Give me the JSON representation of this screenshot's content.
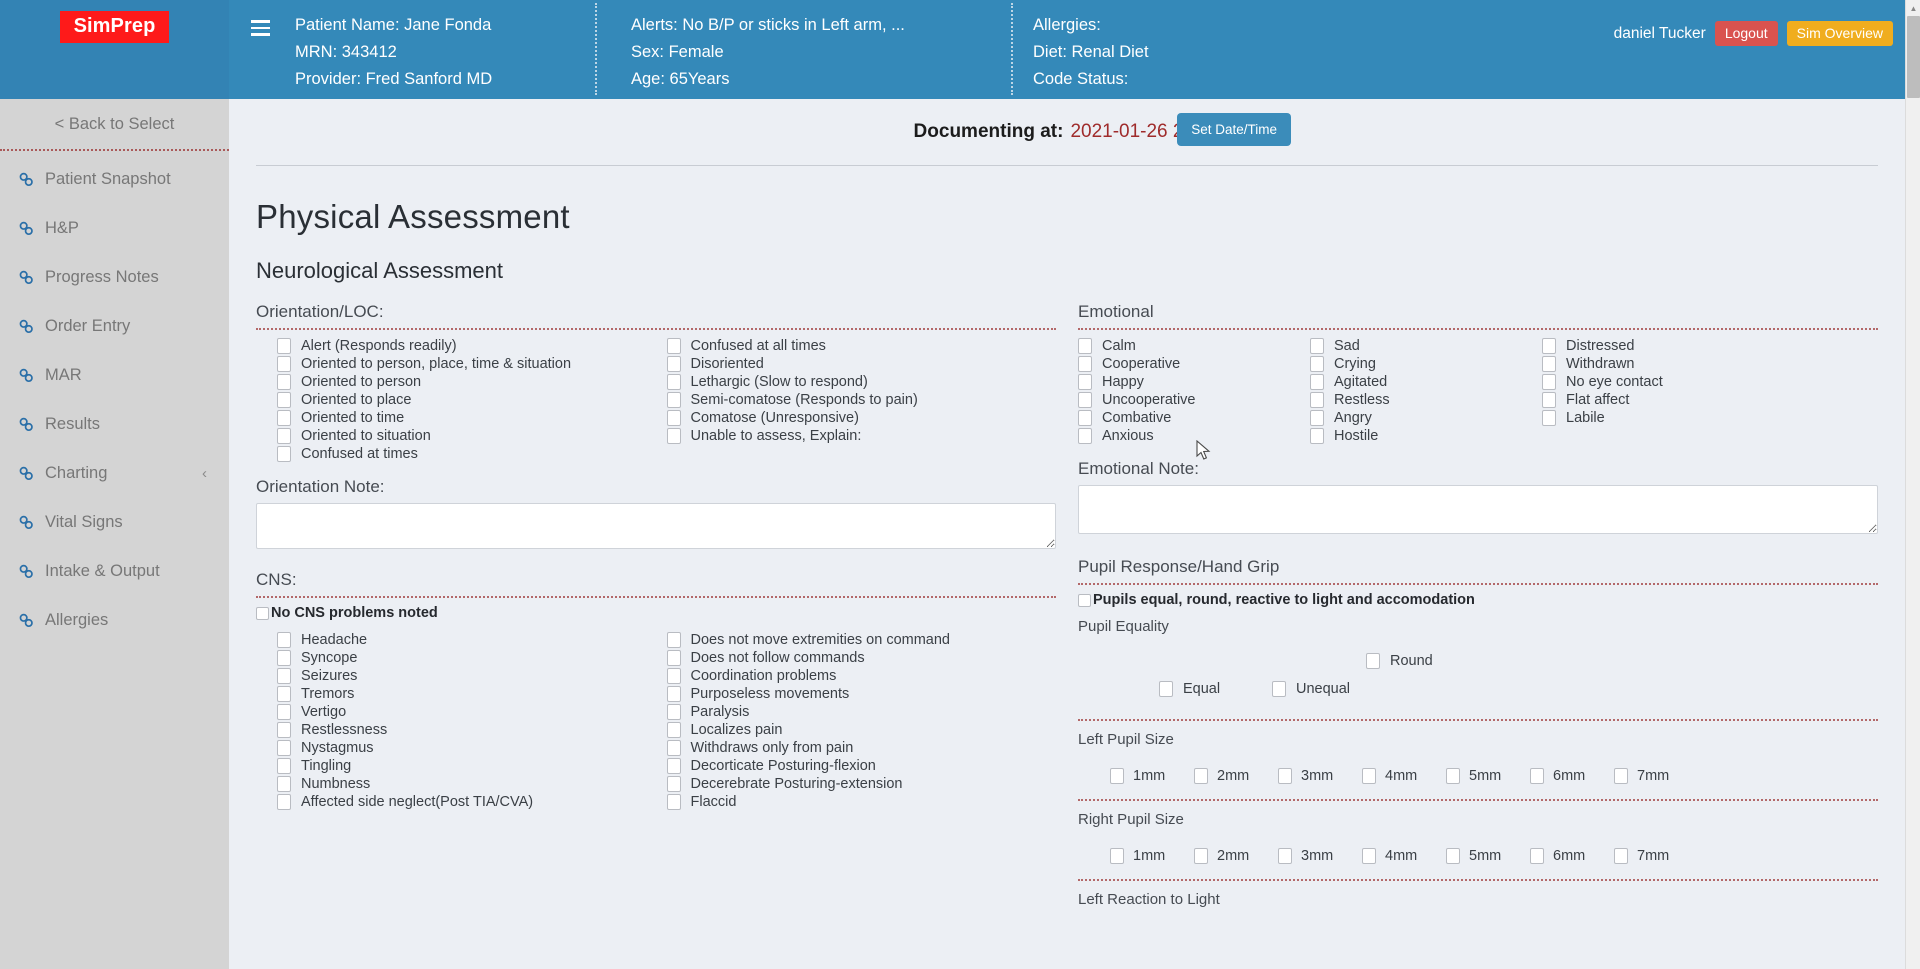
{
  "brand": {
    "name": "SimPrep"
  },
  "header": {
    "patient": {
      "name_label": "Patient Name: Jane Fonda",
      "mrn_label": "MRN: 343412",
      "provider_label": "Provider:  Fred Sanford MD"
    },
    "clinical": {
      "alerts_label": "Alerts: No B/P or sticks in Left arm, ...",
      "sex_label": "Sex: Female",
      "age_label": "Age: 65Years"
    },
    "care": {
      "allergies_label": "Allergies:",
      "diet_label": "Diet:  Renal Diet",
      "code_status_label": "Code Status:"
    },
    "user": "daniel Tucker",
    "logout_label": "Logout",
    "sim_overview_label": "Sim Overview"
  },
  "sidebar": {
    "back_label": "< Back to Select",
    "items": [
      {
        "label": "Patient Snapshot",
        "icon": "link-icon"
      },
      {
        "label": "H&P",
        "icon": "link-icon"
      },
      {
        "label": "Progress Notes",
        "icon": "link-icon"
      },
      {
        "label": "Order Entry",
        "icon": "link-icon"
      },
      {
        "label": "MAR",
        "icon": "link-icon"
      },
      {
        "label": "Results",
        "icon": "link-icon"
      },
      {
        "label": "Charting",
        "icon": "link-icon",
        "chevron": "‹"
      },
      {
        "label": "Vital Signs",
        "icon": "link-icon"
      },
      {
        "label": "Intake & Output",
        "icon": "link-icon"
      },
      {
        "label": "Allergies",
        "icon": "link-icon"
      }
    ]
  },
  "documenting": {
    "label": "Documenting at:",
    "value": "2021-01-26 20:27",
    "set_button_label": "Set Date/Time"
  },
  "page": {
    "title": "Physical Assessment",
    "section": "Neurological Assessment"
  },
  "orientation": {
    "title": "Orientation/LOC:",
    "left_options": [
      "Alert (Responds readily)",
      "Oriented to person, place, time & situation",
      "Oriented to person",
      "Oriented to place",
      "Oriented to time",
      "Oriented to situation",
      "Confused at times"
    ],
    "right_options": [
      "Confused at all times",
      "Disoriented",
      "Lethargic (Slow to respond)",
      "Semi-comatose (Responds to pain)",
      "Comatose (Unresponsive)",
      "Unable to assess, Explain:"
    ],
    "note_label": "Orientation Note:",
    "note_value": ""
  },
  "cns": {
    "title": "CNS:",
    "no_problems_label": "No CNS problems noted",
    "left_options": [
      "Headache",
      "Syncope",
      "Seizures",
      "Tremors",
      "Vertigo",
      "Restlessness",
      "Nystagmus",
      "Tingling",
      "Numbness",
      "Affected side neglect(Post TIA/CVA)"
    ],
    "right_options": [
      "Does not move extremities on command",
      "Does not follow commands",
      "Coordination problems",
      "Purposeless movements",
      "Paralysis",
      "Localizes pain",
      "Withdraws only from pain",
      "Decorticate Posturing-flexion",
      "Decerebrate Posturing-extension",
      "Flaccid"
    ]
  },
  "emotional": {
    "title": "Emotional",
    "col1": [
      "Calm",
      "Cooperative",
      "Happy",
      "Uncooperative",
      "Combative",
      "Anxious"
    ],
    "col2": [
      "Sad",
      "Crying",
      "Agitated",
      "Restless",
      "Angry",
      "Hostile"
    ],
    "col3": [
      "Distressed",
      "Withdrawn",
      "No eye contact",
      "Flat affect",
      "Labile"
    ],
    "note_label": "Emotional Note:",
    "note_value": ""
  },
  "pupil": {
    "title": "Pupil Response/Hand Grip",
    "perrla_label": "Pupils equal, round, reactive to light and accomodation",
    "equality_label": "Pupil Equality",
    "equality_options": [
      "Round",
      "Equal",
      "Unequal"
    ],
    "left_size_label": "Left Pupil Size",
    "right_size_label": "Right Pupil Size",
    "sizes": [
      "1mm",
      "2mm",
      "3mm",
      "4mm",
      "5mm",
      "6mm",
      "7mm"
    ],
    "left_reaction_label": "Left Reaction to Light"
  },
  "colors": {
    "header_blue": "#3489b9",
    "brand_red": "#fe1a1a",
    "logout_red": "#d9534f",
    "sim_orange": "#f0ad1e",
    "button_blue": "#3b8cba",
    "doc_value_red": "#9f2b2b",
    "sidebar_gray": "#d4d4d4",
    "content_bg": "#eceff4",
    "rule_red": "#a03b3b"
  }
}
